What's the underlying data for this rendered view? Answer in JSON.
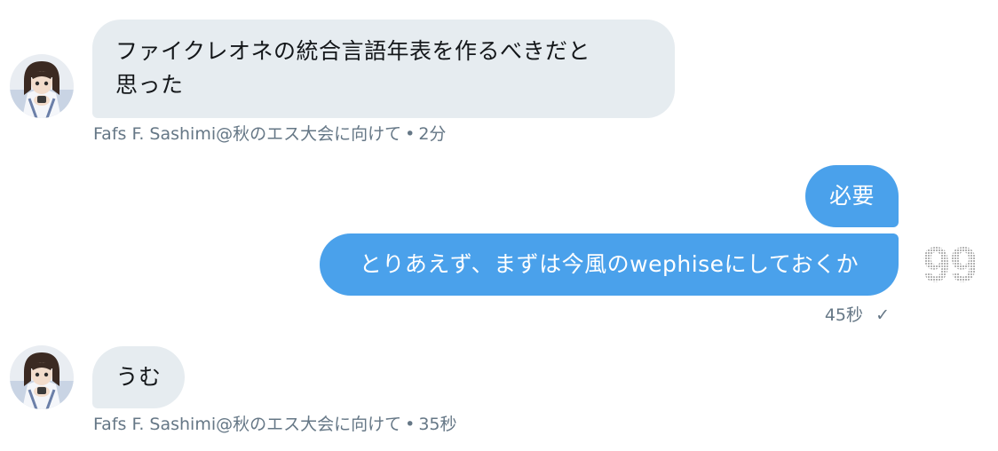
{
  "colors": {
    "incoming_bubble": "#e6ecf0",
    "outgoing_bubble": "#4aa1eb",
    "meta_text": "#657786"
  },
  "messages": [
    {
      "direction": "incoming",
      "lines": [
        "ファイクレオネの統合言語年表を作るべきだと",
        "思った"
      ],
      "sender": "Fafs F. Sashimi@秋のエス大会に向けて",
      "separator": "•",
      "time": "2分"
    },
    {
      "direction": "outgoing",
      "text": "必要"
    },
    {
      "direction": "outgoing",
      "text": "とりあえず、まずは今風のwephiseにしておくか",
      "time": "45秒",
      "status_icon": "checkmark-icon",
      "status_glyph": "✓"
    },
    {
      "direction": "incoming",
      "text": "うむ",
      "sender": "Fafs F. Sashimi@秋のエス大会に向けて",
      "separator": "•",
      "time": "35秒"
    }
  ],
  "decorations": {
    "ascii_art": "99"
  }
}
